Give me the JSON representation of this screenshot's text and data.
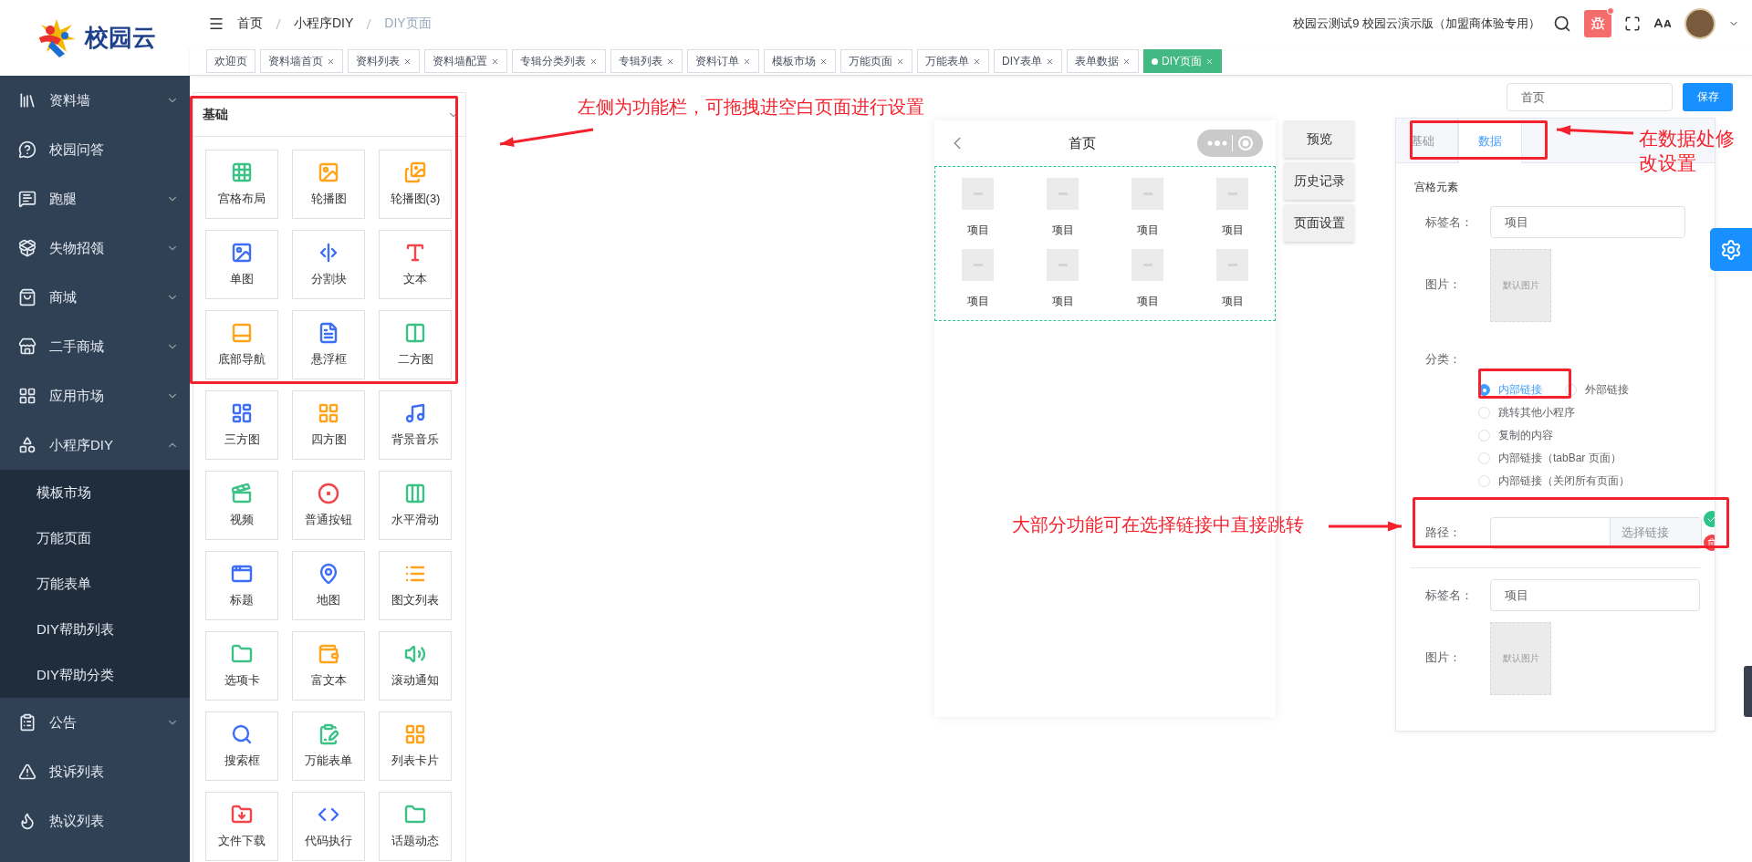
{
  "logo": {
    "name": "校园云"
  },
  "header": {
    "breadcrumb": [
      {
        "label": "首页",
        "current": false
      },
      {
        "label": "小程序DIY",
        "current": false
      },
      {
        "label": "DIY页面",
        "current": true
      }
    ],
    "account": "校园云测试9 校园云演示版（加盟商体验专用）",
    "notification_dot": true
  },
  "tags": [
    {
      "label": "欢迎页",
      "closable": false,
      "selected": false
    },
    {
      "label": "资料墙首页",
      "closable": true,
      "selected": false
    },
    {
      "label": "资料列表",
      "closable": true,
      "selected": false
    },
    {
      "label": "资料墙配置",
      "closable": true,
      "selected": false
    },
    {
      "label": "专辑分类列表",
      "closable": true,
      "selected": false
    },
    {
      "label": "专辑列表",
      "closable": true,
      "selected": false
    },
    {
      "label": "资料订单",
      "closable": true,
      "selected": false
    },
    {
      "label": "模板市场",
      "closable": true,
      "selected": false
    },
    {
      "label": "万能页面",
      "closable": true,
      "selected": false
    },
    {
      "label": "万能表单",
      "closable": true,
      "selected": false
    },
    {
      "label": "DIY表单",
      "closable": true,
      "selected": false
    },
    {
      "label": "表单数据",
      "closable": true,
      "selected": false
    },
    {
      "label": "DIY页面",
      "closable": true,
      "selected": true
    }
  ],
  "sidebar": {
    "items": [
      {
        "label": "资料墙",
        "arrow": true,
        "expanded": false
      },
      {
        "label": "校园问答",
        "arrow": false
      },
      {
        "label": "跑腿",
        "arrow": true,
        "expanded": false
      },
      {
        "label": "失物招领",
        "arrow": true,
        "expanded": false
      },
      {
        "label": "商城",
        "arrow": true,
        "expanded": false
      },
      {
        "label": "二手商城",
        "arrow": true,
        "expanded": false
      },
      {
        "label": "应用市场",
        "arrow": true,
        "expanded": false
      },
      {
        "label": "小程序DIY",
        "arrow": true,
        "expanded": true,
        "children": [
          {
            "label": "模板市场"
          },
          {
            "label": "万能页面"
          },
          {
            "label": "万能表单"
          },
          {
            "label": "DIY帮助列表"
          },
          {
            "label": "DIY帮助分类"
          }
        ]
      },
      {
        "label": "公告",
        "arrow": true,
        "expanded": false
      },
      {
        "label": "投诉列表",
        "arrow": false
      },
      {
        "label": "热议列表",
        "arrow": false
      }
    ]
  },
  "components": {
    "title": "基础",
    "items": [
      {
        "label": "宫格布局",
        "color": "#3cc287"
      },
      {
        "label": "轮播图",
        "color": "#ffa31a"
      },
      {
        "label": "轮播图(3)",
        "color": "#ffa31a"
      },
      {
        "label": "单图",
        "color": "#3d6ef5"
      },
      {
        "label": "分割块",
        "color": "#3d6ef5"
      },
      {
        "label": "文本",
        "color": "#f0454b"
      },
      {
        "label": "底部导航",
        "color": "#ffa31a"
      },
      {
        "label": "悬浮框",
        "color": "#3d6ef5"
      },
      {
        "label": "二方图",
        "color": "#3cc287"
      },
      {
        "label": "三方图",
        "color": "#3d6ef5"
      },
      {
        "label": "四方图",
        "color": "#ffa31a"
      },
      {
        "label": "背景音乐",
        "color": "#3d6ef5"
      },
      {
        "label": "视频",
        "color": "#3cc287"
      },
      {
        "label": "普通按钮",
        "color": "#f0454b"
      },
      {
        "label": "水平滑动",
        "color": "#3cc287"
      },
      {
        "label": "标题",
        "color": "#3d6ef5"
      },
      {
        "label": "地图",
        "color": "#3d6ef5"
      },
      {
        "label": "图文列表",
        "color": "#ffa31a"
      },
      {
        "label": "选项卡",
        "color": "#3cc287"
      },
      {
        "label": "富文本",
        "color": "#ffa31a"
      },
      {
        "label": "滚动通知",
        "color": "#3cc287"
      },
      {
        "label": "搜索框",
        "color": "#3d6ef5"
      },
      {
        "label": "万能表单",
        "color": "#3cc287"
      },
      {
        "label": "列表卡片",
        "color": "#ffa31a"
      },
      {
        "label": "文件下载",
        "color": "#f0454b"
      },
      {
        "label": "代码执行",
        "color": "#3d6ef5"
      },
      {
        "label": "话题动态",
        "color": "#3cc287"
      }
    ]
  },
  "page_name": {
    "value": "首页"
  },
  "save_button": "保存",
  "preview": {
    "title": "首页",
    "items": [
      {
        "label": "项目"
      },
      {
        "label": "项目"
      },
      {
        "label": "项目"
      },
      {
        "label": "项目"
      },
      {
        "label": "项目"
      },
      {
        "label": "项目"
      },
      {
        "label": "项目"
      },
      {
        "label": "项目"
      }
    ]
  },
  "side_buttons": [
    "预览",
    "历史记录",
    "页面设置"
  ],
  "settings": {
    "tabs": [
      {
        "label": "基础",
        "selected": false
      },
      {
        "label": "数据",
        "selected": true
      }
    ],
    "section": "宫格元素",
    "entries": [
      {
        "fields": [
          {
            "kind": "text",
            "label": "标签名：",
            "value": "项目"
          },
          {
            "kind": "image",
            "label": "图片：",
            "placeholder_text": "默认图片"
          },
          {
            "kind": "radio",
            "label": "分类：",
            "options": [
              {
                "label": "内部链接",
                "selected": true
              },
              {
                "label": "外部链接",
                "selected": false
              },
              {
                "label": "跳转其他小程序",
                "selected": false
              },
              {
                "label": "复制的内容",
                "selected": false
              },
              {
                "label": "内部链接（tabBar 页面）",
                "selected": false
              },
              {
                "label": "内部链接（关闭所有页面）",
                "selected": false
              }
            ]
          },
          {
            "kind": "link",
            "label": "路径：",
            "button": "选择链接"
          }
        ]
      },
      {
        "fields": [
          {
            "kind": "text",
            "label": "标签名：",
            "value": "项目"
          },
          {
            "kind": "image",
            "label": "图片：",
            "placeholder_text": "默认图片"
          }
        ]
      }
    ]
  },
  "annotations": [
    {
      "text": "左侧为功能栏，可拖拽进空白页面进行设置"
    },
    {
      "text": "在数据处修改设置"
    },
    {
      "text": "大部分功能可在选择链接中直接跳转"
    }
  ]
}
